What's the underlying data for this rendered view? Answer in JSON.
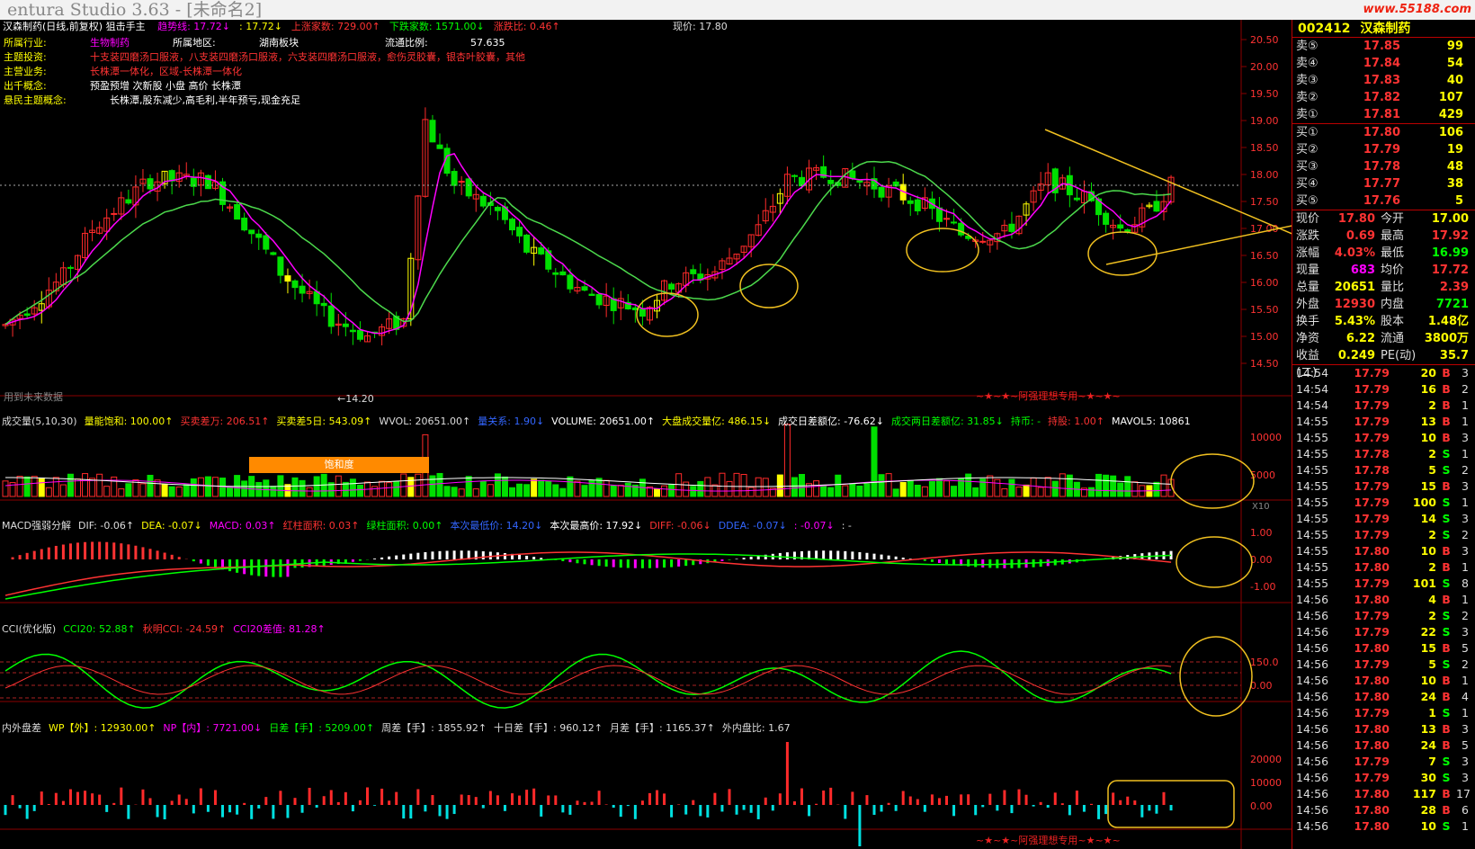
{
  "window": {
    "title": "entura Studio 3.63 - [未命名2]",
    "logo": "www.55188.com"
  },
  "main": {
    "title": "汉森制药(日线,前复权) 狙击手主",
    "indicators": [
      {
        "label": "趋势线: 17.72↓",
        "color": "#ff00ff"
      },
      {
        "label": ": 17.72↓",
        "color": "#ffff00"
      },
      {
        "label": "上涨家数: 729.00↑",
        "color": "#ff3333"
      },
      {
        "label": "下跌家数: 1571.00↓",
        "color": "#00ff00"
      },
      {
        "label": "涨跌比: 0.46↑",
        "color": "#ff3333"
      }
    ],
    "current_price": "现价: 17.80",
    "info": [
      {
        "k": "所属行业:",
        "v": "生物制药",
        "k2": "所属地区:",
        "v2": "湖南板块",
        "k3": "流通比例:",
        "v3": "57.635"
      },
      {
        "k": "主题投资:",
        "v": "十支装四磨汤口服液，八支装四磨汤口服液，六支装四磨汤口服液，愈伤灵胶囊，银杏叶胶囊，其他"
      },
      {
        "k": "主营业务:",
        "v": "长株潭一体化，区域-长株潭一体化"
      },
      {
        "k": "出千概念:",
        "v": "预盈预增 次新股 小盘 高价 长株潭"
      },
      {
        "k": "悬民主题概念:",
        "v": "长株潭,股东减少,高毛利,半年预亏,现金充足"
      }
    ],
    "low_label": "←14.20",
    "future_data": "用到未来数据",
    "stamp": "~★~★~阿强理想专用~★~★~",
    "yaxis": [
      "20.50",
      "20.00",
      "19.50",
      "19.00",
      "18.50",
      "18.00",
      "17.50",
      "17.00",
      "16.50",
      "16.00",
      "15.50",
      "15.00",
      "14.50"
    ]
  },
  "volume": {
    "header": [
      {
        "t": "成交量(5,10,30)",
        "c": "#dddddd"
      },
      {
        "t": "量能饱和: 100.00↑",
        "c": "#ffff00"
      },
      {
        "t": "买卖差万: 206.51↑",
        "c": "#ff3333"
      },
      {
        "t": "买卖差5日: 543.09↑",
        "c": "#ffff00"
      },
      {
        "t": "WVOL: 20651.00↑",
        "c": "#dddddd"
      },
      {
        "t": "量关系: 1.90↓",
        "c": "#3366ff"
      },
      {
        "t": "VOLUME: 20651.00↑",
        "c": "#ffffff"
      },
      {
        "t": "大盘成交量亿: 486.15↓",
        "c": "#ffff00"
      },
      {
        "t": "成交日差额亿: -76.62↓",
        "c": "#ffffff"
      },
      {
        "t": "成交两日差额亿: 31.85↓",
        "c": "#00ff00"
      },
      {
        "t": "持币: -",
        "c": "#00ff00"
      },
      {
        "t": "持股: 1.00↑",
        "c": "#ff3333"
      },
      {
        "t": "MAVOL5: 10861",
        "c": "#ffffff"
      }
    ],
    "saturation": "饱和度",
    "yaxis": [
      "10000",
      "5000"
    ],
    "x10": "X10"
  },
  "macd": {
    "header": [
      {
        "t": "MACD强弱分解",
        "c": "#dddddd"
      },
      {
        "t": "DIF: -0.06↑",
        "c": "#dddddd"
      },
      {
        "t": "DEA: -0.07↓",
        "c": "#ffff00"
      },
      {
        "t": "MACD: 0.03↑",
        "c": "#ff00ff"
      },
      {
        "t": "红柱面积: 0.03↑",
        "c": "#ff3333"
      },
      {
        "t": "绿柱面积: 0.00↑",
        "c": "#00ff00"
      },
      {
        "t": "本次最低价: 14.20↓",
        "c": "#3366ff"
      },
      {
        "t": "本次最高价: 17.92↓",
        "c": "#ffffff"
      },
      {
        "t": "DIFF: -0.06↓",
        "c": "#ff3333"
      },
      {
        "t": "DDEA: -0.07↓",
        "c": "#3366ff"
      },
      {
        "t": ": -0.07↓",
        "c": "#ff00ff"
      },
      {
        "t": ": -",
        "c": "#dddddd"
      }
    ],
    "yaxis": [
      "1.00",
      "0.00",
      "-1.00"
    ]
  },
  "cci": {
    "header": [
      {
        "t": "CCI(优化版)",
        "c": "#dddddd"
      },
      {
        "t": "CCI20: 52.88↑",
        "c": "#00ff00"
      },
      {
        "t": "秋明CCI: -24.59↑",
        "c": "#ff3333"
      },
      {
        "t": "CCI20差值: 81.28↑",
        "c": "#ff00ff"
      }
    ],
    "yaxis": [
      "150.0",
      "0.00"
    ]
  },
  "flow": {
    "header": [
      {
        "t": "内外盘差",
        "c": "#dddddd"
      },
      {
        "t": "WP【外】: 12930.00↑",
        "c": "#ffff00"
      },
      {
        "t": "NP【内】: 7721.00↓",
        "c": "#ff00ff"
      },
      {
        "t": "日差【手】: 5209.00↑",
        "c": "#00ff00"
      },
      {
        "t": "周差【手】: 1855.92↑",
        "c": "#dddddd"
      },
      {
        "t": "十日差【手】: 960.12↑",
        "c": "#dddddd"
      },
      {
        "t": "月差【手】: 1165.37↑",
        "c": "#dddddd"
      },
      {
        "t": "外内盘比: 1.67",
        "c": "#dddddd"
      }
    ],
    "yaxis": [
      "20000",
      "10000",
      "0.00"
    ],
    "stamp": "~★~★~阿强理想专用~★~★~"
  },
  "quote": {
    "code": "002412",
    "name": "汉森制药",
    "sells": [
      {
        "l": "卖⑤",
        "p": "17.85",
        "v": "99"
      },
      {
        "l": "卖④",
        "p": "17.84",
        "v": "54"
      },
      {
        "l": "卖③",
        "p": "17.83",
        "v": "40"
      },
      {
        "l": "卖②",
        "p": "17.82",
        "v": "107"
      },
      {
        "l": "卖①",
        "p": "17.81",
        "v": "429"
      }
    ],
    "buys": [
      {
        "l": "买①",
        "p": "17.80",
        "v": "106"
      },
      {
        "l": "买②",
        "p": "17.79",
        "v": "19"
      },
      {
        "l": "买③",
        "p": "17.78",
        "v": "48"
      },
      {
        "l": "买④",
        "p": "17.77",
        "v": "38"
      },
      {
        "l": "买⑤",
        "p": "17.76",
        "v": "5"
      }
    ],
    "stats": [
      {
        "k": "现价",
        "v": "17.80",
        "vc": "#ff3333",
        "k2": "今开",
        "v2": "17.00",
        "v2c": "#ffff00"
      },
      {
        "k": "涨跌",
        "v": "0.69",
        "vc": "#ff3333",
        "k2": "最高",
        "v2": "17.92",
        "v2c": "#ff3333"
      },
      {
        "k": "涨幅",
        "v": "4.03%",
        "vc": "#ff3333",
        "k2": "最低",
        "v2": "16.99",
        "v2c": "#00ff00"
      },
      {
        "k": "现量",
        "v": "683",
        "vc": "#ff00ff",
        "k2": "均价",
        "v2": "17.72",
        "v2c": "#ff3333"
      },
      {
        "k": "总量",
        "v": "20651",
        "vc": "#ffff00",
        "k2": "量比",
        "v2": "2.39",
        "v2c": "#ff3333"
      },
      {
        "k": "外盘",
        "v": "12930",
        "vc": "#ff3333",
        "k2": "内盘",
        "v2": "7721",
        "v2c": "#00ff00"
      },
      {
        "k": "换手",
        "v": "5.43%",
        "vc": "#ffff00",
        "k2": "股本",
        "v2": "1.48亿",
        "v2c": "#ffff00"
      },
      {
        "k": "净资",
        "v": "6.22",
        "vc": "#ffff00",
        "k2": "流通",
        "v2": "3800万",
        "v2c": "#ffff00"
      },
      {
        "k": "收益(二)",
        "v": "0.249",
        "vc": "#ffff00",
        "k2": "PE(动)",
        "v2": "35.7",
        "v2c": "#ffff00"
      }
    ],
    "ticks": [
      {
        "t": "14:54",
        "p": "17.79",
        "v": "20",
        "s": "B",
        "n": "3"
      },
      {
        "t": "14:54",
        "p": "17.79",
        "v": "16",
        "s": "B",
        "n": "2"
      },
      {
        "t": "14:54",
        "p": "17.79",
        "v": "2",
        "s": "B",
        "n": "1"
      },
      {
        "t": "14:55",
        "p": "17.79",
        "v": "13",
        "s": "B",
        "n": "1"
      },
      {
        "t": "14:55",
        "p": "17.79",
        "v": "10",
        "s": "B",
        "n": "3"
      },
      {
        "t": "14:55",
        "p": "17.78",
        "v": "2",
        "s": "S",
        "n": "1"
      },
      {
        "t": "14:55",
        "p": "17.78",
        "v": "5",
        "s": "S",
        "n": "2"
      },
      {
        "t": "14:55",
        "p": "17.79",
        "v": "15",
        "s": "B",
        "n": "3"
      },
      {
        "t": "14:55",
        "p": "17.79",
        "v": "100",
        "s": "S",
        "n": "1"
      },
      {
        "t": "14:55",
        "p": "17.79",
        "v": "14",
        "s": "S",
        "n": "3"
      },
      {
        "t": "14:55",
        "p": "17.79",
        "v": "2",
        "s": "S",
        "n": "2"
      },
      {
        "t": "14:55",
        "p": "17.80",
        "v": "10",
        "s": "B",
        "n": "3"
      },
      {
        "t": "14:55",
        "p": "17.80",
        "v": "2",
        "s": "B",
        "n": "1"
      },
      {
        "t": "14:55",
        "p": "17.79",
        "v": "101",
        "s": "S",
        "n": "8"
      },
      {
        "t": "14:56",
        "p": "17.80",
        "v": "4",
        "s": "B",
        "n": "1"
      },
      {
        "t": "14:56",
        "p": "17.79",
        "v": "2",
        "s": "S",
        "n": "2"
      },
      {
        "t": "14:56",
        "p": "17.79",
        "v": "22",
        "s": "S",
        "n": "3"
      },
      {
        "t": "14:56",
        "p": "17.80",
        "v": "15",
        "s": "B",
        "n": "5"
      },
      {
        "t": "14:56",
        "p": "17.79",
        "v": "5",
        "s": "S",
        "n": "2"
      },
      {
        "t": "14:56",
        "p": "17.80",
        "v": "10",
        "s": "B",
        "n": "1"
      },
      {
        "t": "14:56",
        "p": "17.80",
        "v": "24",
        "s": "B",
        "n": "4"
      },
      {
        "t": "14:56",
        "p": "17.79",
        "v": "1",
        "s": "S",
        "n": "1"
      },
      {
        "t": "14:56",
        "p": "17.80",
        "v": "13",
        "s": "B",
        "n": "3"
      },
      {
        "t": "14:56",
        "p": "17.80",
        "v": "24",
        "s": "B",
        "n": "5"
      },
      {
        "t": "14:56",
        "p": "17.79",
        "v": "7",
        "s": "S",
        "n": "3"
      },
      {
        "t": "14:56",
        "p": "17.79",
        "v": "30",
        "s": "S",
        "n": "3"
      },
      {
        "t": "14:56",
        "p": "17.80",
        "v": "117",
        "s": "B",
        "n": "17"
      },
      {
        "t": "14:56",
        "p": "17.80",
        "v": "28",
        "s": "B",
        "n": "6"
      },
      {
        "t": "14:56",
        "p": "17.80",
        "v": "10",
        "s": "S",
        "n": "1"
      }
    ]
  },
  "colors": {
    "up": "#ff2a2a",
    "down": "#00e000",
    "grid": "#8b0000",
    "ma_main": "#ff00ff",
    "trend": "#4cd94c",
    "annot": "#f0c020"
  }
}
